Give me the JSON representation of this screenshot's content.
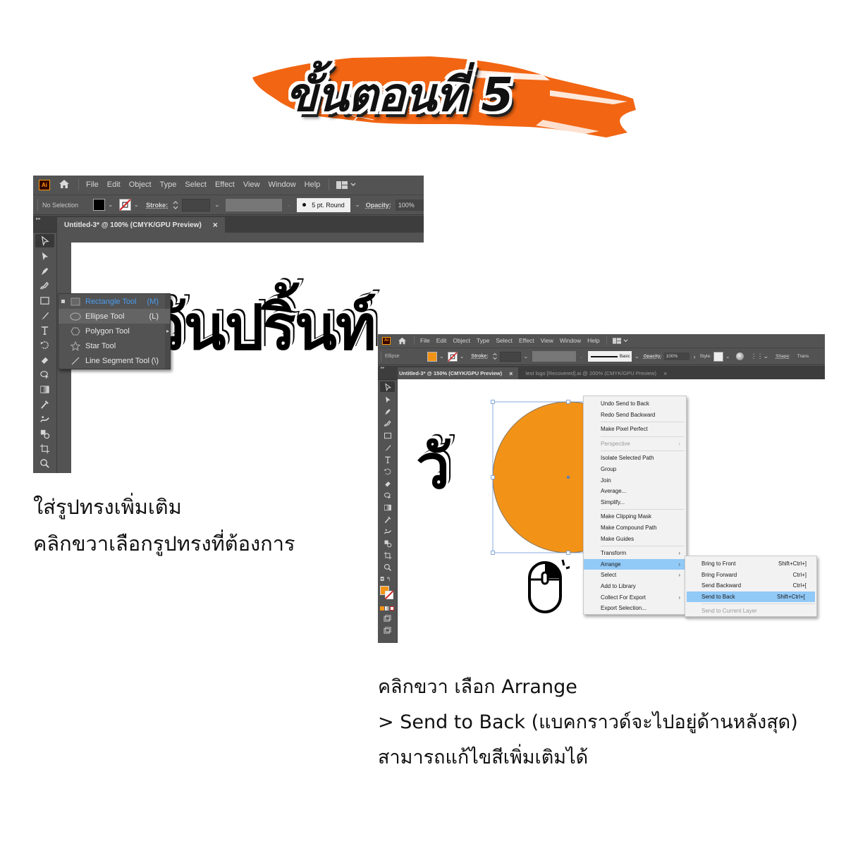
{
  "header": {
    "title": "ขั้นตอนที่ 5",
    "brush_color": "#f26513"
  },
  "window1": {
    "menu": [
      "File",
      "Edit",
      "Object",
      "Type",
      "Select",
      "Effect",
      "View",
      "Window",
      "Help"
    ],
    "app_icon": "Ai",
    "control": {
      "selection_label": "No Selection",
      "fill_color": "#000000",
      "stroke_label": "Stroke:",
      "brush_label": "5 pt. Round",
      "opacity_label": "Opacity:",
      "opacity_value": "100%"
    },
    "doc_tab": "Untitled-3* @ 100% (CMYK/GPU Preview)",
    "flyout": [
      {
        "label": "Rectangle Tool",
        "shortcut": "(M)",
        "icon": "rectangle-icon",
        "active": true
      },
      {
        "label": "Ellipse Tool",
        "shortcut": "(L)",
        "icon": "ellipse-icon",
        "highlighted": true
      },
      {
        "label": "Polygon Tool",
        "shortcut": "",
        "icon": "polygon-icon"
      },
      {
        "label": "Star Tool",
        "shortcut": "",
        "icon": "star-icon"
      },
      {
        "label": "Line Segment Tool",
        "shortcut": "(\\)",
        "icon": "line-icon"
      }
    ],
    "artwork_text": "วันปริ้นท์"
  },
  "window2": {
    "menu": [
      "File",
      "Edit",
      "Object",
      "Type",
      "Select",
      "Effect",
      "View",
      "Window",
      "Help"
    ],
    "app_icon": "Ai",
    "control": {
      "selection_label": "Ellipse",
      "fill_color": "#f29318",
      "stroke_label": "Stroke:",
      "brush_label": "Basic",
      "opacity_label": "Opacity:",
      "opacity_value": "100%",
      "style_label": "Style:",
      "shape_label": "Shape:",
      "transform_label": "Trans"
    },
    "doc_tabs": [
      "Untitled-3* @ 150% (CMYK/GPU Preview)",
      "test logo [Recovered].ai @ 200% (CMYK/GPU Preview)"
    ],
    "circle_color": "#f29318",
    "context_menu": [
      {
        "label": "Undo Send to Back"
      },
      {
        "label": "Redo Send Backward"
      },
      {
        "sep": true
      },
      {
        "label": "Make Pixel Perfect"
      },
      {
        "sep": true
      },
      {
        "label": "Perspective",
        "submenu": true,
        "disabled": true
      },
      {
        "sep": true
      },
      {
        "label": "Isolate Selected Path"
      },
      {
        "label": "Group"
      },
      {
        "label": "Join"
      },
      {
        "label": "Average..."
      },
      {
        "label": "Simplify..."
      },
      {
        "sep": true
      },
      {
        "label": "Make Clipping Mask"
      },
      {
        "label": "Make Compound Path"
      },
      {
        "label": "Make Guides"
      },
      {
        "sep": true
      },
      {
        "label": "Transform",
        "submenu": true
      },
      {
        "label": "Arrange",
        "submenu": true,
        "highlighted": true
      },
      {
        "label": "Select",
        "submenu": true
      },
      {
        "label": "Add to Library"
      },
      {
        "label": "Collect For Export",
        "submenu": true
      },
      {
        "label": "Export Selection..."
      }
    ],
    "arrange_submenu": [
      {
        "label": "Bring to Front",
        "shortcut": "Shift+Ctrl+]"
      },
      {
        "label": "Bring Forward",
        "shortcut": "Ctrl+]"
      },
      {
        "label": "Send Backward",
        "shortcut": "Ctrl+["
      },
      {
        "label": "Send to Back",
        "shortcut": "Shift+Ctrl+[",
        "highlighted": true
      },
      {
        "sep": true
      },
      {
        "label": "Send to Current Layer",
        "disabled": true
      }
    ],
    "artwork_text": "วั"
  },
  "captions": {
    "step_left": [
      "ใส่รูปทรงเพิ่มเติม",
      "คลิกขวาเลือกรูปทรงที่ต้องการ"
    ],
    "step_right": [
      "คลิกขวา เลือก Arrange",
      "> Send to Back (แบคกราวด์จะไปอยู่ด้านหลังสุด)",
      "สามารถแก้ไขสีเพิ่มเติมได้"
    ]
  },
  "submenu_arrow": "›",
  "close_glyph": "×",
  "highlight_color": "#91c9f7"
}
